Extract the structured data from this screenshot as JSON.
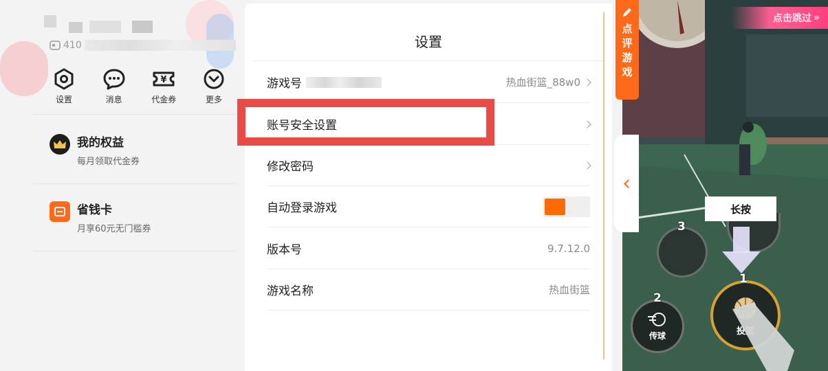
{
  "left_panel": {
    "uid_prefix": "410",
    "shortcuts": [
      {
        "icon": "gear-icon",
        "label": "设置"
      },
      {
        "icon": "message-icon",
        "label": "消息"
      },
      {
        "icon": "voucher-icon",
        "label": "代金券"
      },
      {
        "icon": "more-icon",
        "label": "更多"
      }
    ],
    "benefits": [
      {
        "icon": "crown-icon",
        "title": "我的权益",
        "subtitle": "每月领取代金券"
      },
      {
        "icon": "savings-card-icon",
        "title": "省钱卡",
        "subtitle": "月享60元无门槛券"
      }
    ]
  },
  "settings": {
    "title": "设置",
    "rows": [
      {
        "label": "游戏号",
        "value": "热血街篮_88w0"
      },
      {
        "label": "账号安全设置",
        "value": ""
      },
      {
        "label": "修改密码",
        "value": ""
      },
      {
        "label": "自动登录游戏",
        "toggle_on": true
      },
      {
        "label": "版本号",
        "value": "9.7.12.0"
      },
      {
        "label": "游戏名称",
        "value": "热血街篮"
      }
    ]
  },
  "review_tab": {
    "label": "点评游戏"
  },
  "game": {
    "skip_label": "点击跳过",
    "long_press_label": "长按",
    "buttons": [
      {
        "number": "3",
        "label": ""
      },
      {
        "number": "2",
        "label": "传球"
      },
      {
        "number": "1",
        "label": "投篮"
      }
    ]
  },
  "colors": {
    "accent": "#ff6a00",
    "highlight_border": "#e94b47",
    "skip_pink": "#ff4f88"
  }
}
